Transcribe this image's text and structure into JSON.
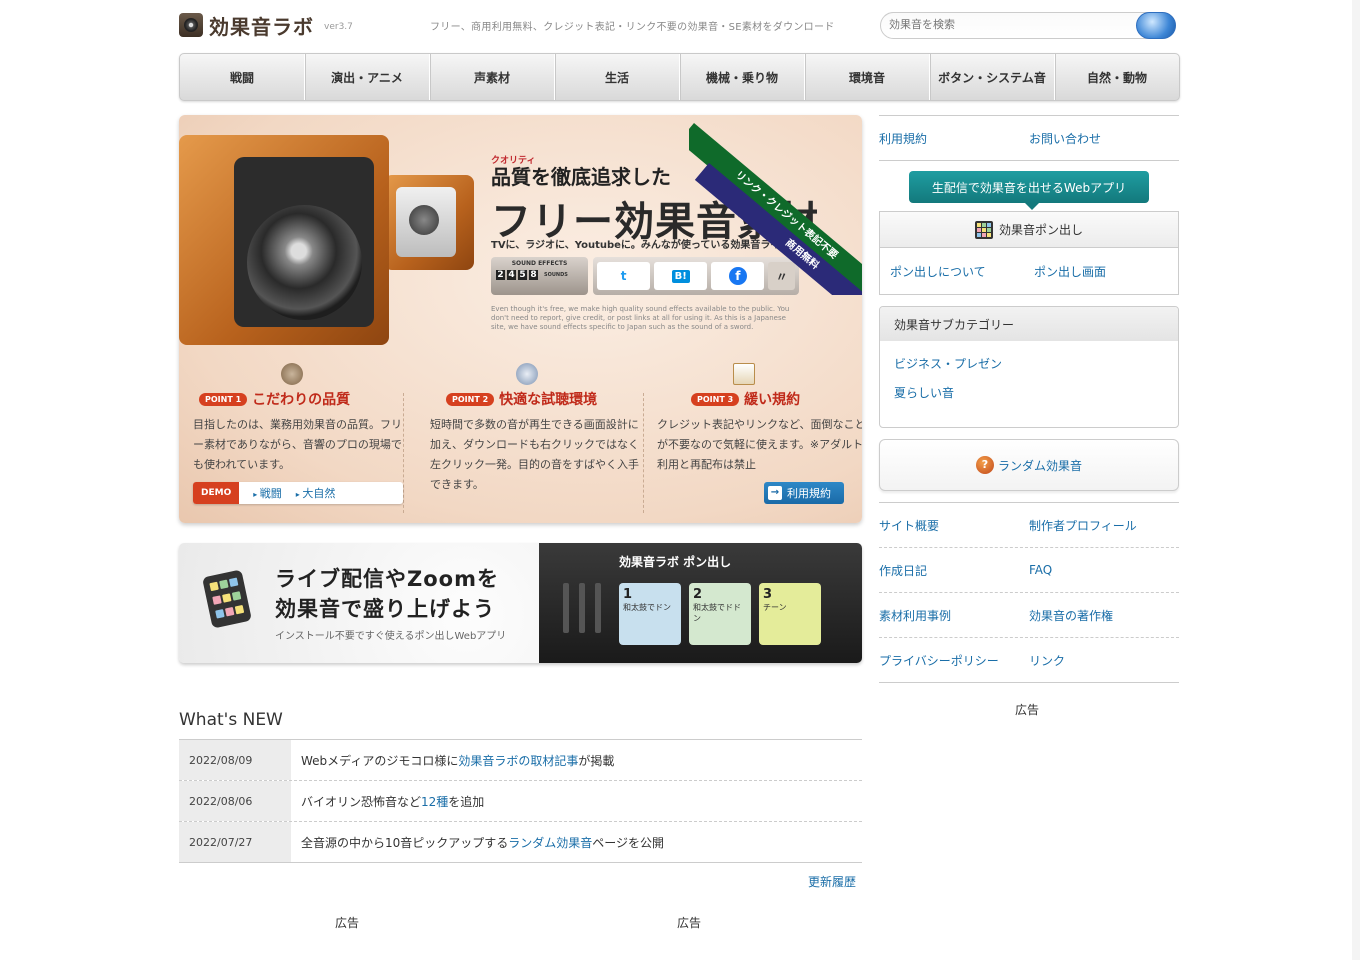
{
  "header": {
    "logo_text": "効果音ラボ",
    "version": "ver3.7",
    "tagline": "フリー、商用利用無料、クレジット表記・リンク不要の効果音・SE素材をダウンロード",
    "search_placeholder": "効果音を検索"
  },
  "nav": [
    "戦闘",
    "演出・アニメ",
    "声素材",
    "生活",
    "機械・乗り物",
    "環境音",
    "ボタン・システム音",
    "自然・動物"
  ],
  "hero": {
    "quality_ruby": "クオリティ",
    "catch": "品質を徹底追求した",
    "title": "フリー効果音素材",
    "subtitle": "TVに、ラジオに、Youtubeに。みんなが使っている効果音ライブラリ",
    "ribbon_top": "商用無料",
    "ribbon_bottom": "リンク・クレジット表記不要",
    "counter_label": "SOUND EFFECTS",
    "counter_digits": [
      "2",
      "4",
      "5",
      "8"
    ],
    "counter_unit": "SOUNDS",
    "share": {
      "twitter": "t",
      "hatena": "B!",
      "facebook": "f"
    },
    "english": "Even though it's free, we make high quality sound effects available to the public. You don't need to report, give credit, or post links at all for using it. As this is a Japanese site, we have sound effects specific to Japan such as the sound of a sword.",
    "points": [
      {
        "badge": "POINT 1",
        "title": "こだわりの品質",
        "text": "目指したのは、業務用効果音の品質。フリー素材でありながら、音響のプロの現場でも使われています。"
      },
      {
        "badge": "POINT 2",
        "title": "快適な試聴環境",
        "text": "短時間で多数の音が再生できる画面設計に加え、ダウンロードも右クリックではなく左クリック一発。目的の音をすばやく入手できます。"
      },
      {
        "badge": "POINT 3",
        "title": "緩い規約",
        "text": "クレジット表記やリンクなど、面倒なことが不要なので気軽に使えます。※アダルト利用と再配布は禁止"
      }
    ],
    "demo_label": "DEMO",
    "demo_links": [
      "戦闘",
      "大自然"
    ],
    "terms_button": "利用規約"
  },
  "live_banner": {
    "line1": "ライブ配信やZoomを",
    "line2": "効果音で盛り上げよう",
    "line3": "インストール不要ですぐ使えるポン出しWebアプリ",
    "app_title": "効果音ラボ ポン出し",
    "pads": [
      {
        "num": "1",
        "label": "和太鼓でドン",
        "color": "#c8e0ee"
      },
      {
        "num": "2",
        "label": "和太鼓でドドン",
        "color": "#d4e8cf"
      },
      {
        "num": "3",
        "label": "チーン",
        "color": "#e4ec9a"
      }
    ]
  },
  "news": {
    "heading": "What's NEW",
    "rows": [
      {
        "date": "2022/08/09",
        "pre": "Webメディアのジモコロ様に",
        "link": "効果音ラボの取材記事",
        "post": "が掲載"
      },
      {
        "date": "2022/08/06",
        "pre": "バイオリン恐怖音など",
        "link": "12種",
        "post": "を追加"
      },
      {
        "date": "2022/07/27",
        "pre": "全音源の中から10音ピックアップする",
        "link": "ランダム効果音",
        "post": "ページを公開"
      }
    ],
    "history_link": "更新履歴"
  },
  "ads": {
    "label": "広告"
  },
  "sidebar": {
    "top_links": [
      "利用規約",
      "お問い合わせ"
    ],
    "pon_banner": "生配信で効果音を出せるWebアプリ",
    "pon_title": "効果音ポン出し",
    "pon_links": [
      "ポン出しについて",
      "ポン出し画面"
    ],
    "subcat_heading": "効果音サブカテゴリー",
    "subcat_links": [
      "ビジネス・プレゼン",
      "夏らしい音"
    ],
    "random_label": "ランダム効果音",
    "links": [
      [
        "サイト概要",
        "制作者プロフィール"
      ],
      [
        "作成日記",
        "FAQ"
      ],
      [
        "素材利用事例",
        "効果音の著作権"
      ],
      [
        "プライバシーポリシー",
        "リンク"
      ]
    ]
  },
  "colors": {
    "accent_red": "#c02a1a",
    "link_blue": "#1a6ea8",
    "teal": "#13797c"
  }
}
